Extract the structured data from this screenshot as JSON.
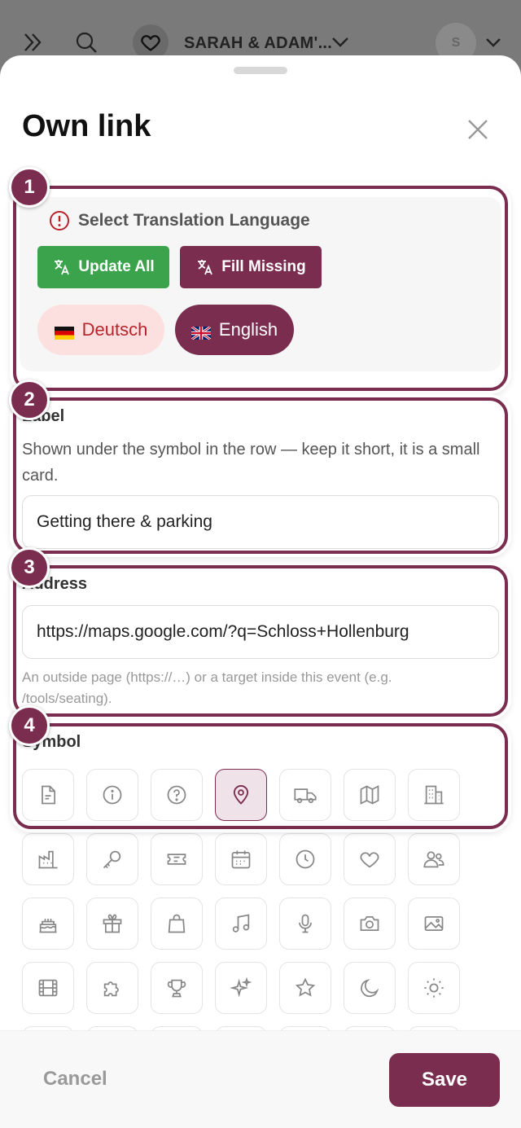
{
  "header": {
    "event_name": "SARAH & ADAM'...",
    "avatar_initial": "S"
  },
  "sheet": {
    "title": "Own link"
  },
  "steps": [
    "1",
    "2",
    "3",
    "4"
  ],
  "translation": {
    "title": "Select Translation Language",
    "update_all": "Update All",
    "fill_missing": "Fill Missing",
    "languages": [
      {
        "label": "Deutsch",
        "selected": false
      },
      {
        "label": "English",
        "selected": true
      }
    ]
  },
  "label_field": {
    "label": "Label",
    "help": "Shown under the symbol in the row — keep it short, it is a small card.",
    "value": "Getting there & parking"
  },
  "address_field": {
    "label": "Address",
    "value": "https://maps.google.com/?q=Schloss+Hollenburg",
    "help": "An outside page (https://…) or a target inside this event (e.g. /tools/seating)."
  },
  "symbol_field": {
    "label": "Symbol",
    "selected": "map-pin",
    "icons": [
      [
        "document",
        "info",
        "question",
        "map-pin",
        "truck",
        "map",
        "building"
      ],
      [
        "factory",
        "key",
        "ticket",
        "calendar",
        "clock",
        "heart",
        "people"
      ],
      [
        "cake",
        "gift",
        "shopping-bag",
        "music",
        "microphone",
        "camera",
        "image"
      ],
      [
        "film",
        "puzzle",
        "trophy",
        "sparkles",
        "star",
        "moon",
        "sun"
      ]
    ]
  },
  "footer": {
    "cancel": "Cancel",
    "save": "Save"
  },
  "colors": {
    "accent": "#7b2d4f",
    "green": "#3aa34b",
    "danger": "#b8242b"
  }
}
